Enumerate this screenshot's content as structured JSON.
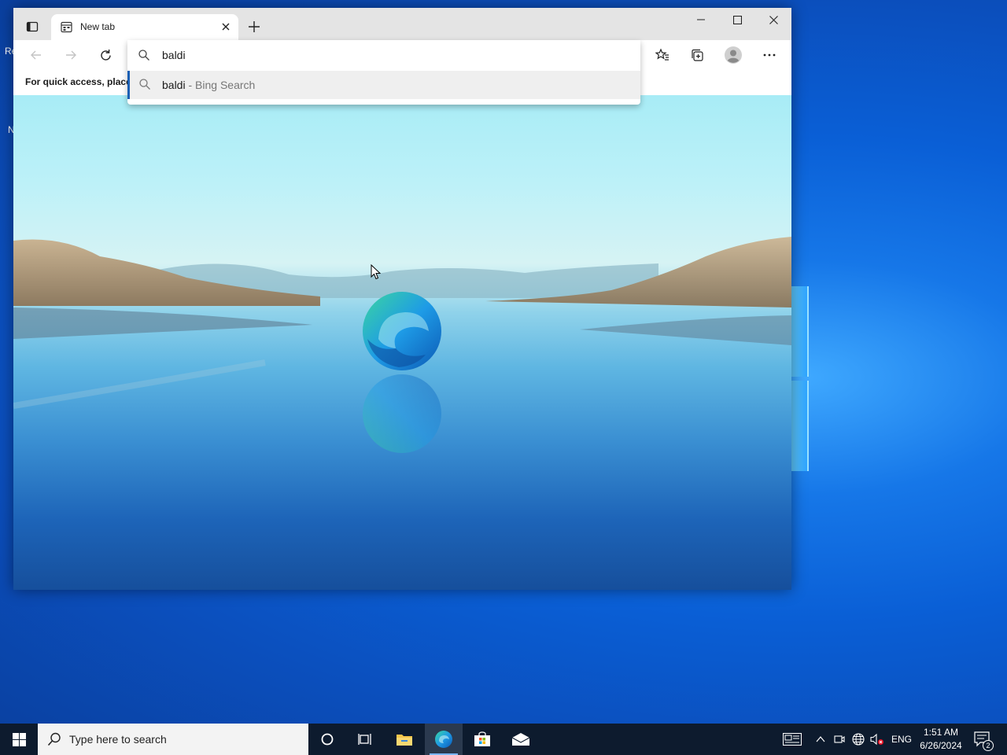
{
  "desktop": {
    "fragments": [
      "Re",
      "N"
    ]
  },
  "browser": {
    "tab_title": "New tab",
    "address_query": "baldi",
    "suggestion": {
      "query": "baldi",
      "separator": "-",
      "source": "Bing Search"
    },
    "favorites_hint": "For quick access, place y"
  },
  "taskbar": {
    "search_placeholder": "Type here to search",
    "language": "ENG",
    "time": "1:51 AM",
    "date": "6/26/2024",
    "notification_count": "2"
  },
  "colors": {
    "accent": "#1a5fb4",
    "taskbar": "#0d1b2e",
    "desktop": "#0a5fd6"
  }
}
